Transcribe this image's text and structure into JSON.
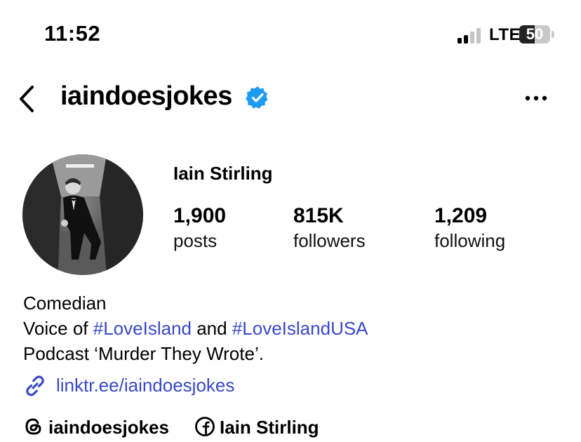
{
  "status_bar": {
    "time": "11:52",
    "network": "LTE",
    "battery": "50",
    "battery_level": 0.5,
    "signal_bars_active": 2,
    "signal_bars_total": 4
  },
  "header": {
    "username": "iaindoesjokes",
    "verified": true,
    "back_icon": "chevron-left-icon",
    "more_icon": "ellipsis-icon"
  },
  "profile": {
    "full_name": "Iain Stirling",
    "stats": [
      {
        "value": "1,900",
        "label": "posts"
      },
      {
        "value": "815K",
        "label": "followers"
      },
      {
        "value": "1,209",
        "label": "following"
      }
    ]
  },
  "bio": {
    "line1": "Comedian",
    "line2_prefix": "Voice of",
    "line2_tag1": "#LoveIsland",
    "line2_mid": "and",
    "line2_tag2": "#LoveIslandUSA",
    "line3": "Podcast ‘Murder They Wrote’.",
    "link": "linktr.ee/iaindoesjokes"
  },
  "socials": {
    "threads": "iaindoesjokes",
    "facebook": "Iain Stirling"
  },
  "colors": {
    "link": "#3848c8",
    "verified": "#1d9bf0",
    "text": "#000000"
  }
}
